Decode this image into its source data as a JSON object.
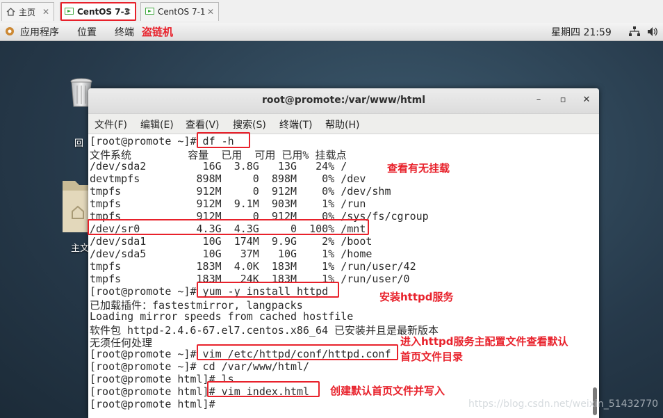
{
  "tabs": [
    {
      "label": "主页",
      "icon": "home-icon"
    },
    {
      "label": "CentOS 7-3",
      "icon": "vm-icon",
      "active": true
    },
    {
      "label": "CentOS 7-1",
      "icon": "vm-icon"
    }
  ],
  "panel": {
    "menus": [
      "应用程序",
      "位置",
      "终端"
    ],
    "annotation": "盗链机",
    "clock": "星期四 21:59"
  },
  "desktop": {
    "trash_label": "回",
    "home_label": "主文"
  },
  "window": {
    "title": "root@promote:/var/www/html",
    "menu": [
      "文件(F)",
      "编辑(E)",
      "查看(V)",
      "搜索(S)",
      "终端(T)",
      "帮助(H)"
    ]
  },
  "terminal_lines": [
    "[root@promote ~]# df -h",
    "文件系统         容量  已用  可用 已用% 挂载点",
    "/dev/sda2         16G  3.8G   13G   24% /",
    "devtmpfs         898M     0  898M    0% /dev",
    "tmpfs            912M     0  912M    0% /dev/shm",
    "tmpfs            912M  9.1M  903M    1% /run",
    "tmpfs            912M     0  912M    0% /sys/fs/cgroup",
    "/dev/sr0         4.3G  4.3G     0  100% /mnt",
    "/dev/sda1         10G  174M  9.9G    2% /boot",
    "/dev/sda5         10G   37M   10G    1% /home",
    "tmpfs            183M  4.0K  183M    1% /run/user/42",
    "tmpfs            183M   24K  183M    1% /run/user/0",
    "[root@promote ~]# yum -y install httpd",
    "已加载插件：fastestmirror, langpacks",
    "Loading mirror speeds from cached hostfile",
    "软件包 httpd-2.4.6-67.el7.centos.x86_64 已安装并且是最新版本",
    "无须任何处理",
    "[root@promote ~]# vim /etc/httpd/conf/httpd.conf",
    "[root@promote ~]# cd /var/www/html/",
    "[root@promote html]# ls",
    "[root@promote html]# vim index.html",
    "[root@promote html]# "
  ],
  "annotations": {
    "df": "查看有无挂载",
    "yum": "安装httpd服务",
    "vim_conf_1": "进入httpd服务主配置文件查看默认",
    "vim_conf_2": "首页文件目录",
    "vim_index": "创建默认首页文件并写入"
  },
  "watermark": "https://blog.csdn.net/weixin_51432770",
  "colors": {
    "annotation": "#e8212b",
    "desktop": "#24394a"
  }
}
